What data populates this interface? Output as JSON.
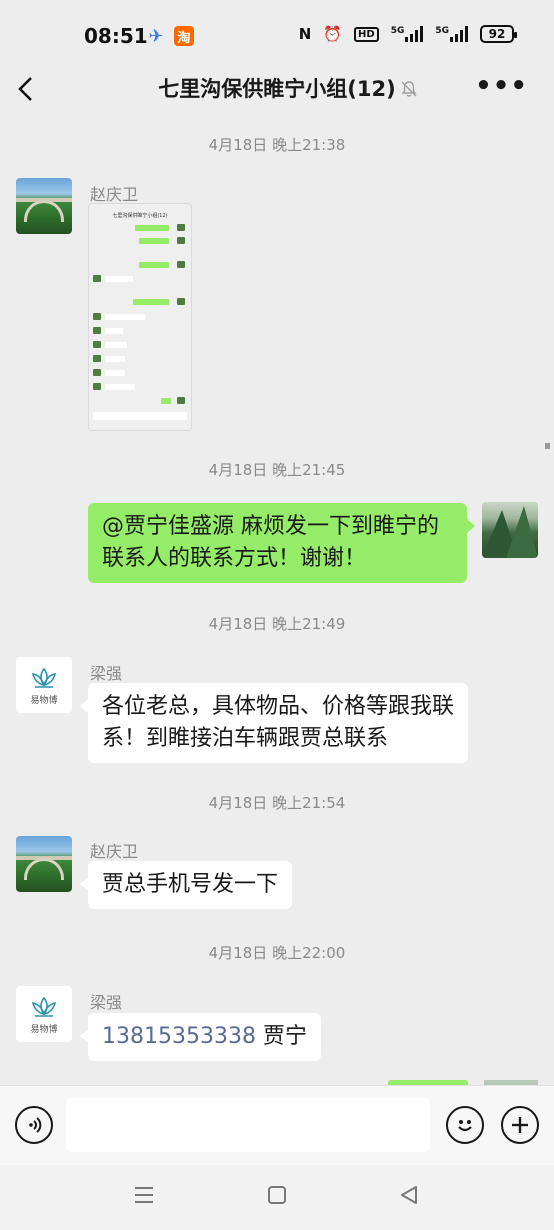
{
  "status_bar": {
    "time": "08:51",
    "taobao_glyph": "淘",
    "hd_label": "HD",
    "net1": "5G",
    "net2": "5G",
    "battery": "92"
  },
  "header": {
    "title": "七里沟保供睢宁小组(12)",
    "back_icon": "chevron-left-icon",
    "mute_icon": "bell-off-icon",
    "more_icon": "more-icon"
  },
  "messages": [
    {
      "type": "timestamp",
      "text": "4月18日 晚上21:38"
    },
    {
      "type": "image",
      "side": "left",
      "sender": "赵庆卫",
      "thumbnail": {
        "title": "七里沟保供睢宁小组(12)"
      }
    },
    {
      "type": "timestamp",
      "text": "4月18日 晚上21:45"
    },
    {
      "type": "text",
      "side": "right",
      "text": "@贾宁佳盛源  麻烦发一下到睢宁的联系人的联系方式！谢谢！"
    },
    {
      "type": "timestamp",
      "text": "4月18日 晚上21:49"
    },
    {
      "type": "text",
      "side": "left",
      "sender": "梁强",
      "text": "各位老总，具体物品、价格等跟我联系！到睢接泊车辆跟贾总联系"
    },
    {
      "type": "timestamp",
      "text": "4月18日 晚上21:54"
    },
    {
      "type": "text",
      "side": "left",
      "sender": "赵庆卫",
      "text": "贾总手机号发一下"
    },
    {
      "type": "timestamp",
      "text": "4月18日 晚上22:00"
    },
    {
      "type": "phone",
      "side": "left",
      "sender": "梁强",
      "phone": "13815353338",
      "suffix": " 贾宁"
    }
  ],
  "avatars": {
    "lotus_brand": "易物博"
  },
  "input_bar": {
    "voice_icon": "voice-icon",
    "emoji_icon": "emoji-icon",
    "plus_icon": "plus-icon",
    "placeholder": ""
  },
  "nav": {
    "menu_icon": "menu-icon",
    "home_icon": "home-icon",
    "back_icon": "back-triangle-icon"
  },
  "colors": {
    "background": "#ededed",
    "own_bubble": "#95ec69",
    "other_bubble": "#ffffff",
    "link": "#576b95"
  }
}
